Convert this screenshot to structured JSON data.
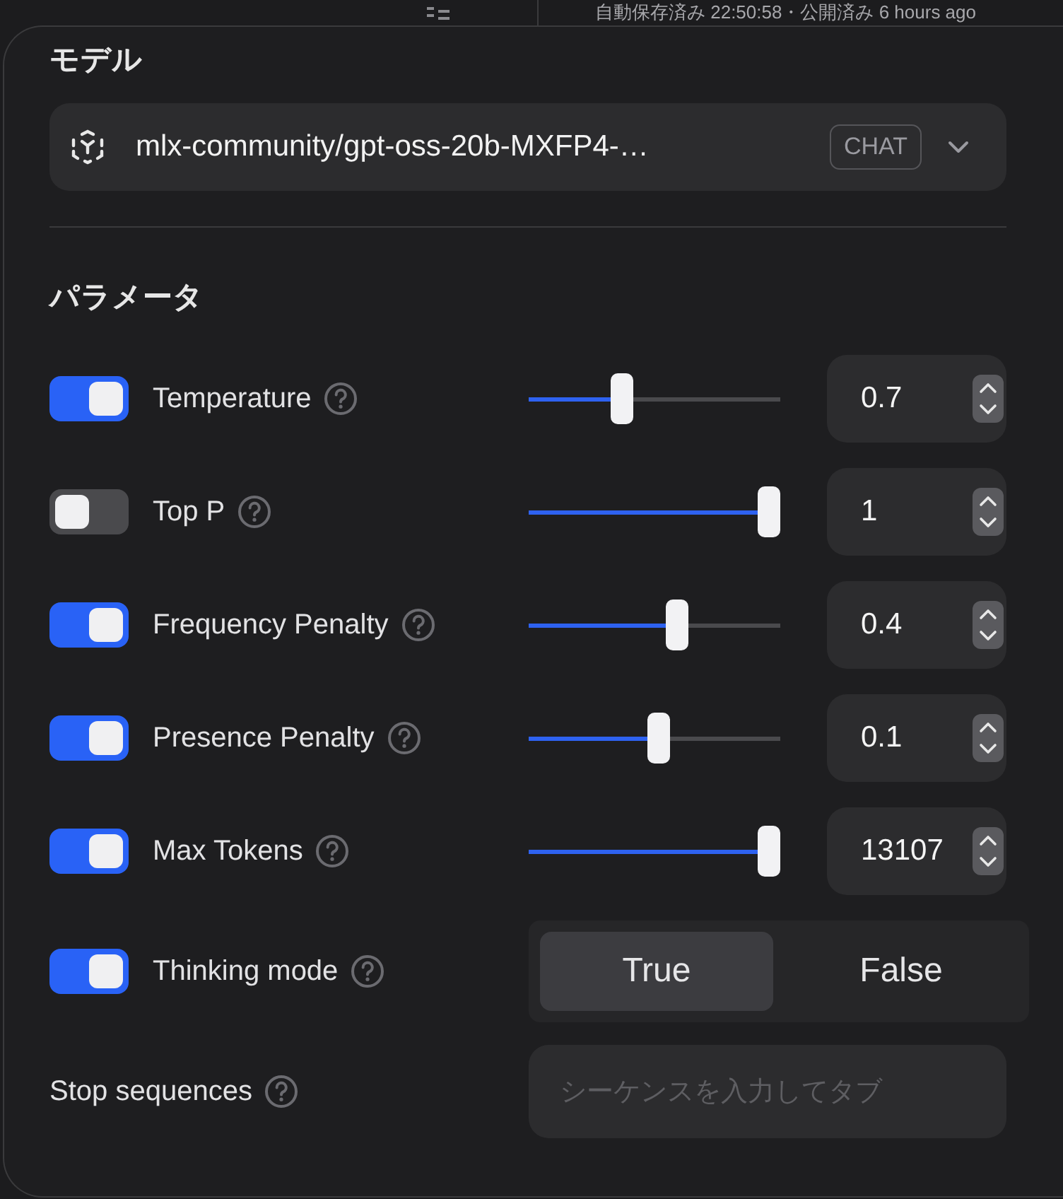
{
  "background": {
    "status_text": "自動保存済み 22:50:58・公開済み 6 hours ago"
  },
  "model_section": {
    "title": "モデル",
    "model_name": "mlx-community/gpt-oss-20b-MXFP4-…",
    "badge": "CHAT"
  },
  "parameters_title": "パラメータ",
  "parameters": [
    {
      "kind": "slider",
      "label": "Temperature",
      "enabled": true,
      "level": 0.36,
      "value": "0.7"
    },
    {
      "kind": "slider",
      "label": "Top P",
      "enabled": false,
      "level": 1,
      "value": "1"
    },
    {
      "kind": "slider",
      "label": "Frequency Penalty",
      "enabled": true,
      "level": 0.6,
      "value": "0.4"
    },
    {
      "kind": "slider",
      "label": "Presence Penalty",
      "enabled": true,
      "level": 0.52,
      "value": "0.1"
    },
    {
      "kind": "slider",
      "label": "Max Tokens",
      "enabled": true,
      "level": 1,
      "value": "13107"
    },
    {
      "kind": "choice",
      "label": "Thinking mode",
      "enabled": true,
      "options": [
        {
          "label": "True",
          "selected": true
        },
        {
          "label": "False",
          "selected": false
        }
      ]
    },
    {
      "kind": "text",
      "label": "Stop sequences",
      "placeholder": "シーケンスを入力してタブ"
    }
  ]
}
